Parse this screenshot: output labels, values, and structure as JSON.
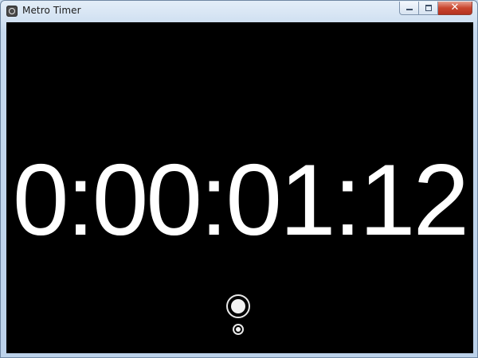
{
  "window": {
    "title": "Metro Timer",
    "icon": "timer-app-icon",
    "controls": {
      "minimize_icon": "minimize-icon",
      "maximize_icon": "maximize-icon",
      "close_icon": "close-icon",
      "close_glyph": "✕"
    }
  },
  "timer": {
    "display": "0:00:01:12"
  },
  "buttons": {
    "start_icon": "circle-button-icon",
    "mode_icon": "small-circle-button-icon"
  },
  "colors": {
    "background": "#000000",
    "digits": "#ffffff",
    "close_button": "#c9452f"
  }
}
